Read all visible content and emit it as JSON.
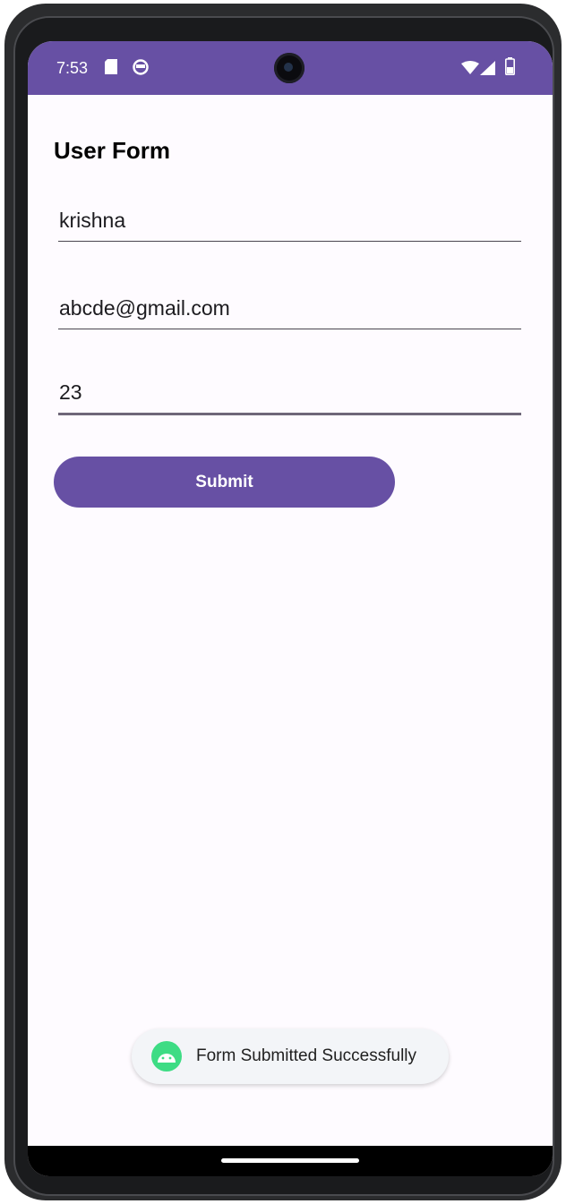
{
  "status_bar": {
    "time": "7:53",
    "icons": [
      "sd-card-icon",
      "app-notification-icon",
      "wifi-icon",
      "cellular-icon",
      "battery-icon"
    ],
    "color": "#6750a4"
  },
  "form": {
    "title": "User Form",
    "fields": [
      {
        "value": "krishna"
      },
      {
        "value": "abcde@gmail.com"
      },
      {
        "value": "23"
      }
    ],
    "submit_label": "Submit",
    "accent_color": "#6750a4"
  },
  "toast": {
    "message": "Form Submitted Successfully",
    "icon": "android-icon",
    "icon_color": "#3ddc84"
  }
}
